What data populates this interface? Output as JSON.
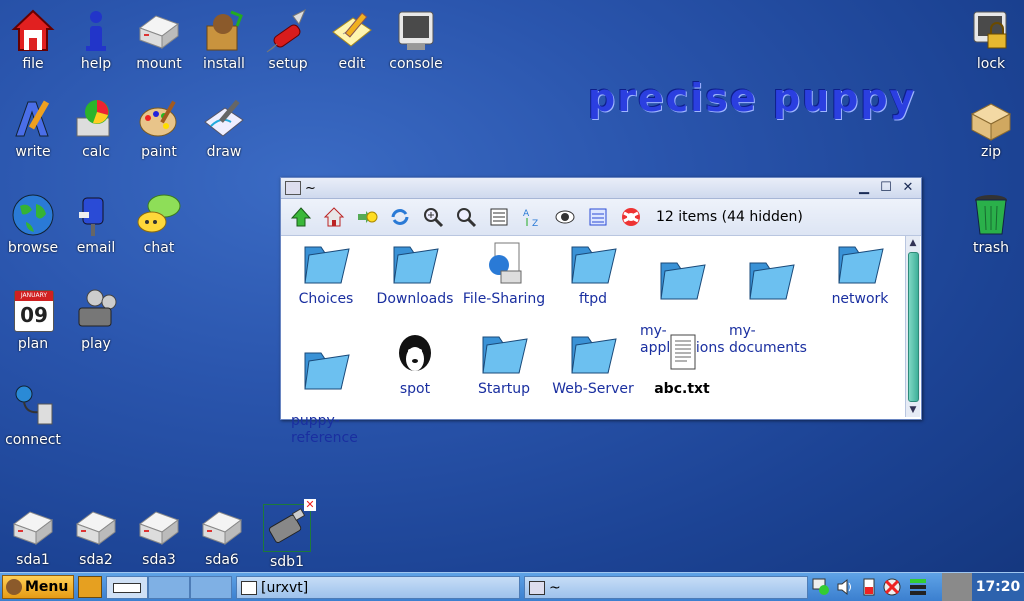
{
  "desktop": {
    "brand": "precise puppy",
    "icons": [
      {
        "label": "file"
      },
      {
        "label": "help"
      },
      {
        "label": "mount"
      },
      {
        "label": "install"
      },
      {
        "label": "setup"
      },
      {
        "label": "edit"
      },
      {
        "label": "console"
      },
      {
        "label": "write"
      },
      {
        "label": "calc"
      },
      {
        "label": "paint"
      },
      {
        "label": "draw"
      },
      {
        "label": "browse"
      },
      {
        "label": "email"
      },
      {
        "label": "chat"
      },
      {
        "label": "plan"
      },
      {
        "label": "play"
      },
      {
        "label": "connect"
      },
      {
        "label": "lock"
      },
      {
        "label": "zip"
      },
      {
        "label": "trash"
      },
      {
        "label": "sda1"
      },
      {
        "label": "sda2"
      },
      {
        "label": "sda3"
      },
      {
        "label": "sda6"
      },
      {
        "label": "sdb1"
      }
    ],
    "calendar_day": "09",
    "calendar_month": "JANUARY"
  },
  "window": {
    "title": "~",
    "status": "12 items (44 hidden)",
    "files": [
      {
        "name": "Choices"
      },
      {
        "name": "Downloads"
      },
      {
        "name": "File-Sharing"
      },
      {
        "name": "ftpd"
      },
      {
        "name": "my-\napplications"
      },
      {
        "name": "my-\ndocuments"
      },
      {
        "name": "network"
      },
      {
        "name": "puppy-\nreference"
      },
      {
        "name": "spot"
      },
      {
        "name": "Startup"
      },
      {
        "name": "Web-Server"
      },
      {
        "name": "abc.txt"
      }
    ]
  },
  "taskbar": {
    "menu_label": "Menu",
    "tasks": [
      {
        "label": "[urxvt]"
      },
      {
        "label": "~"
      }
    ],
    "clock": "17:20"
  },
  "colors": {
    "folder": "#5cb3ea",
    "accent": "#3b7fcf",
    "menu": "#f0b030"
  }
}
